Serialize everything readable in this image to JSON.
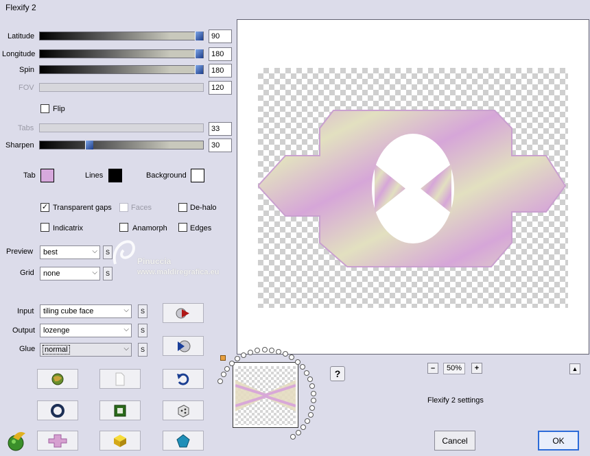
{
  "window": {
    "title": "Flexify 2"
  },
  "params": {
    "latitude": {
      "label": "Latitude",
      "value": "90",
      "level": 1.0
    },
    "longitude": {
      "label": "Longitude",
      "value": "180",
      "level": 1.0
    },
    "spin": {
      "label": "Spin",
      "value": "180",
      "level": 1.0
    },
    "fov": {
      "label": "FOV",
      "value": "120"
    },
    "tabs": {
      "label": "Tabs",
      "value": "33"
    },
    "sharpen": {
      "label": "Sharpen",
      "value": "30",
      "level": 0.3
    }
  },
  "flip": {
    "label": "Flip",
    "checked": false
  },
  "colors": {
    "tab": {
      "label": "Tab",
      "color": "#d7a9dd"
    },
    "lines": {
      "label": "Lines",
      "color": "#000000"
    },
    "background": {
      "label": "Background",
      "color": "#ffffff"
    }
  },
  "options": {
    "transparent_gaps": {
      "label": "Transparent gaps",
      "checked": true
    },
    "faces": {
      "label": "Faces",
      "checked": false
    },
    "de_halo": {
      "label": "De-halo",
      "checked": false
    },
    "indicatrix": {
      "label": "Indicatrix",
      "checked": false
    },
    "anamorph": {
      "label": "Anamorph",
      "checked": false
    },
    "edges": {
      "label": "Edges",
      "checked": false
    }
  },
  "selects": {
    "preview": {
      "label": "Preview",
      "value": "best"
    },
    "grid": {
      "label": "Grid",
      "value": "none"
    },
    "input": {
      "label": "Input",
      "value": "tiling cube face"
    },
    "output": {
      "label": "Output",
      "value": "lozenge"
    },
    "glue": {
      "label": "Glue",
      "value": "normal"
    }
  },
  "s_button_label": "S",
  "watermark": {
    "name": "Pinuccia",
    "site": "www.maldiregrafica.eu"
  },
  "zoom": {
    "value": "50%",
    "minus": "–",
    "plus": "+"
  },
  "help_label": "?",
  "collapse_label": "▲",
  "settings_label": "Flexify 2 settings",
  "buttons": {
    "cancel": "Cancel",
    "ok": "OK"
  },
  "accent": "#2b6bd8",
  "image_colors": {
    "pink": "#d6a6d8",
    "cream": "#e2e0c0"
  }
}
